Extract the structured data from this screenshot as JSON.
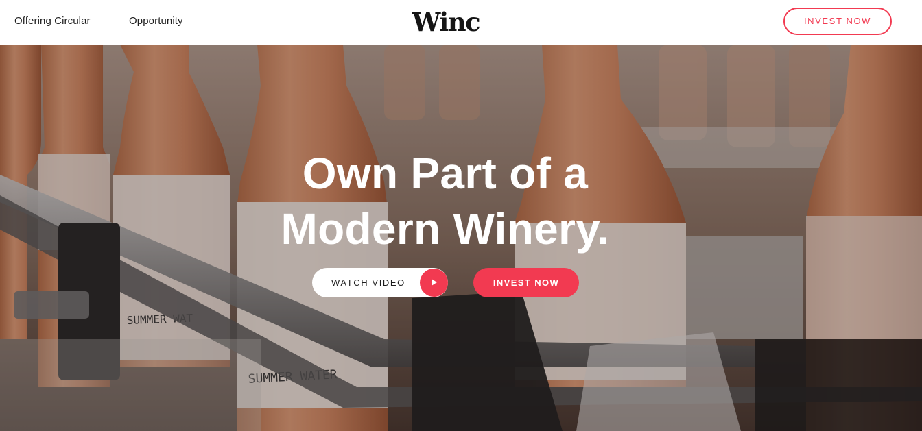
{
  "header": {
    "nav": [
      {
        "label": "Offering Circular"
      },
      {
        "label": "Opportunity"
      }
    ],
    "logo_text": "Winc",
    "cta_label": "INVEST NOW"
  },
  "hero": {
    "headline_line1": "Own Part of a",
    "headline_line2": "Modern Winery.",
    "watch_video_label": "WATCH VIDEO",
    "play_icon": "play-icon",
    "invest_label": "INVEST NOW",
    "bottle_labels": [
      "SUMMER WATER",
      "SUMMER WATER"
    ]
  },
  "colors": {
    "accent": "#f23a51",
    "text_dark": "#1f1f1f",
    "hero_text": "#ffffff"
  }
}
